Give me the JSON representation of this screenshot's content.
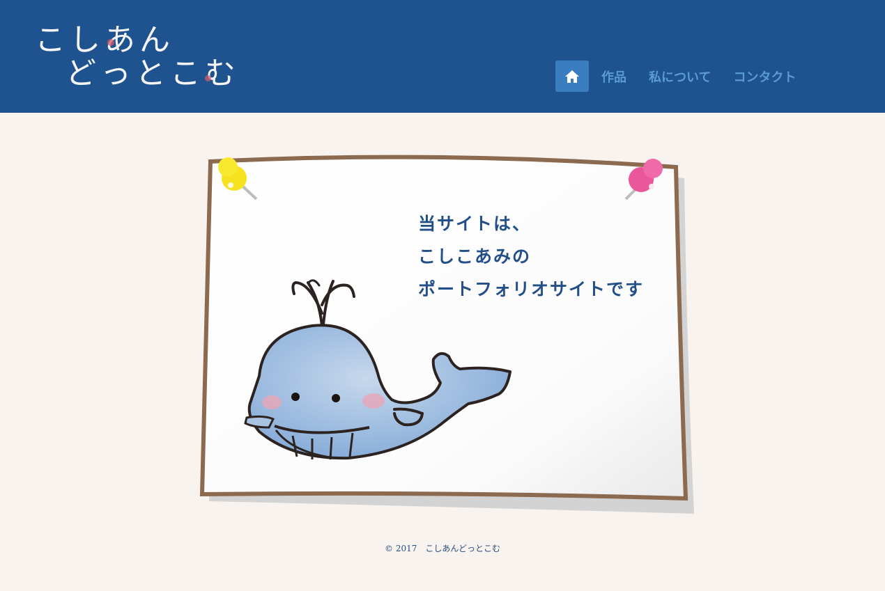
{
  "site": {
    "logo_line1": "こしあん",
    "logo_line2": "どっとこむ"
  },
  "nav": {
    "home_icon": "home-icon",
    "items": [
      {
        "label": "作品"
      },
      {
        "label": "私について"
      },
      {
        "label": "コンタクト"
      }
    ]
  },
  "main": {
    "message_lines": [
      "当サイトは、",
      "こしこあみの",
      "ポートフォリオサイトです"
    ],
    "illustration": "whale-illustration",
    "pins": [
      "yellow-pushpin",
      "pink-pushpin"
    ]
  },
  "footer": {
    "copyright": "© 2017　こしあんどっとこむ"
  },
  "colors": {
    "header_bg": "#1f5390",
    "page_bg": "#f8f3ee",
    "nav_active": "#3a7dc0",
    "nav_text": "#5a9bd6",
    "message_text": "#224f88",
    "board_frame": "#8b6a4f"
  }
}
